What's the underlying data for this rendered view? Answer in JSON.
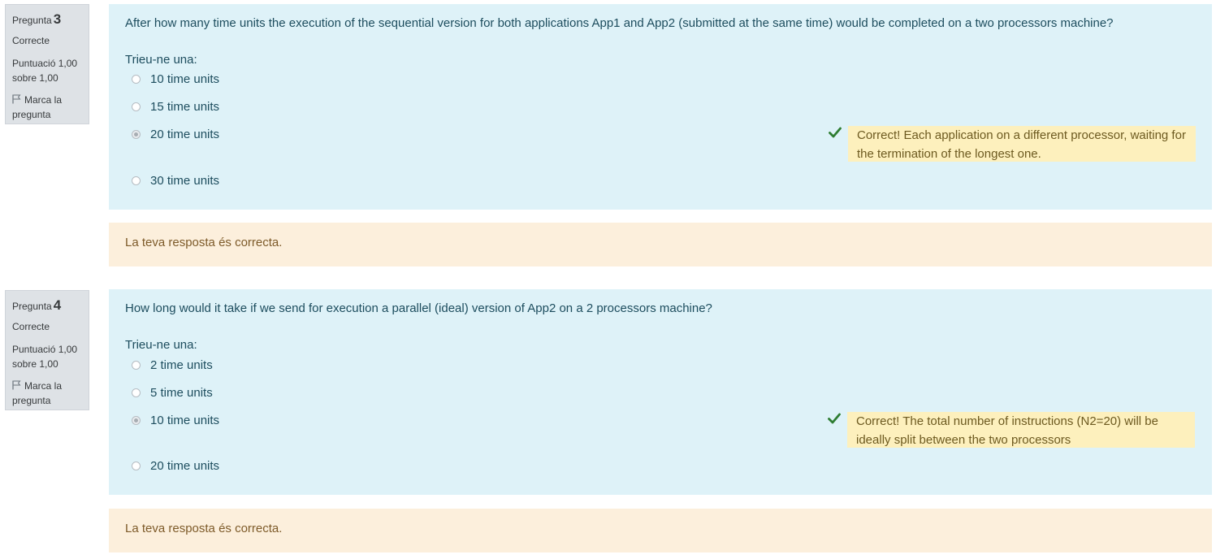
{
  "colors": {
    "info_bg": "#dee2e6",
    "formulation_bg": "#def2f8",
    "outcome_bg": "#fcefdc",
    "feedback_bg": "#fdf0bd",
    "correct_check": "#2e7d32"
  },
  "questions": [
    {
      "info": {
        "label": "Pregunta",
        "number": "3",
        "state": "Correcte",
        "grade_line1": "Puntuació 1,00",
        "grade_line2": "sobre 1,00",
        "flag_line1": "Marca la",
        "flag_line2": "pregunta",
        "flag_icon": "flag-icon"
      },
      "text": "After how many time units the execution of the sequential version for both applications App1 and App2 (submitted at the same time) would be completed on a two processors machine?",
      "prompt": "Trieu-ne una:",
      "options": [
        {
          "label": "10 time units",
          "selected": false
        },
        {
          "label": "15 time units",
          "selected": false
        },
        {
          "label": "20 time units",
          "selected": true
        },
        {
          "label": "30 time units",
          "selected": false
        }
      ],
      "feedback_icon": "check-icon",
      "feedback": "Correct! Each application on a different processor, waiting for the termination of the longest one.",
      "outcome": "La teva resposta és correcta."
    },
    {
      "info": {
        "label": "Pregunta",
        "number": "4",
        "state": "Correcte",
        "grade_line1": "Puntuació 1,00",
        "grade_line2": "sobre 1,00",
        "flag_line1": "Marca la",
        "flag_line2": "pregunta",
        "flag_icon": "flag-icon"
      },
      "text": "How long would it take if we send for execution a parallel (ideal) version of App2 on a 2 processors machine?",
      "prompt": "Trieu-ne una:",
      "options": [
        {
          "label": "2 time units",
          "selected": false
        },
        {
          "label": "5 time units",
          "selected": false
        },
        {
          "label": "10 time units",
          "selected": true
        },
        {
          "label": "20 time units",
          "selected": false
        }
      ],
      "feedback_icon": "check-icon",
      "feedback": "Correct! The total number of instructions (N2=20) will be ideally split between the two processors",
      "outcome": "La teva resposta és correcta."
    }
  ]
}
